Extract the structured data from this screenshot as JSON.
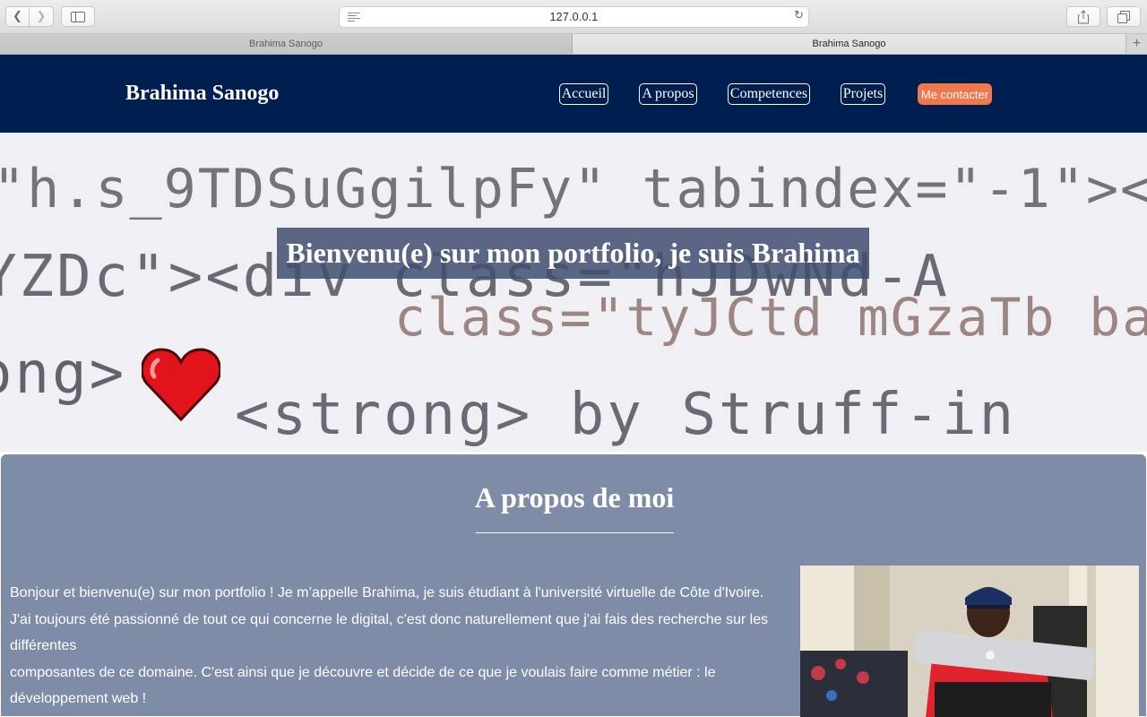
{
  "browser": {
    "url": "127.0.0.1",
    "tabs": [
      {
        "label": "Brahima Sanogo",
        "active": false
      },
      {
        "label": "Brahima Sanogo",
        "active": true
      }
    ]
  },
  "header": {
    "brand": "Brahima Sanogo",
    "nav": [
      "Accueil",
      "A propos",
      "Competences",
      "Projets"
    ],
    "cta": "Me contacter",
    "background": "#011e51",
    "cta_color": "#f1774d"
  },
  "hero": {
    "title": "Bienvenu(e) sur mon portfolio, je suis Brahima",
    "code_lines": [
      "\"h.s_9TDSuGgilpFy\" tabindex=\"-1\"><d",
      "YZDc\"><div class=\"hJDwNd-A",
      "ong>",
      "class=\"tyJCtd mGzaTb ba",
      "<strong> by Struff-in"
    ]
  },
  "about": {
    "title": "A propos de moi",
    "background": "#7f8ca8",
    "paragraph": [
      "Bonjour et bienvenu(e) sur mon portfolio ! Je m’appelle Brahima, je suis étudiant à l'université virtuelle de Côte d'Ivoire.",
      "J'ai toujours été passionné de tout ce qui concerne le digital, c'est donc naturellement que j'ai fais des recherche sur les différentes",
      "composantes de ce domaine. C'est ainsi que je découvre et décide de ce que je voulais faire comme métier : le développement web !"
    ]
  }
}
